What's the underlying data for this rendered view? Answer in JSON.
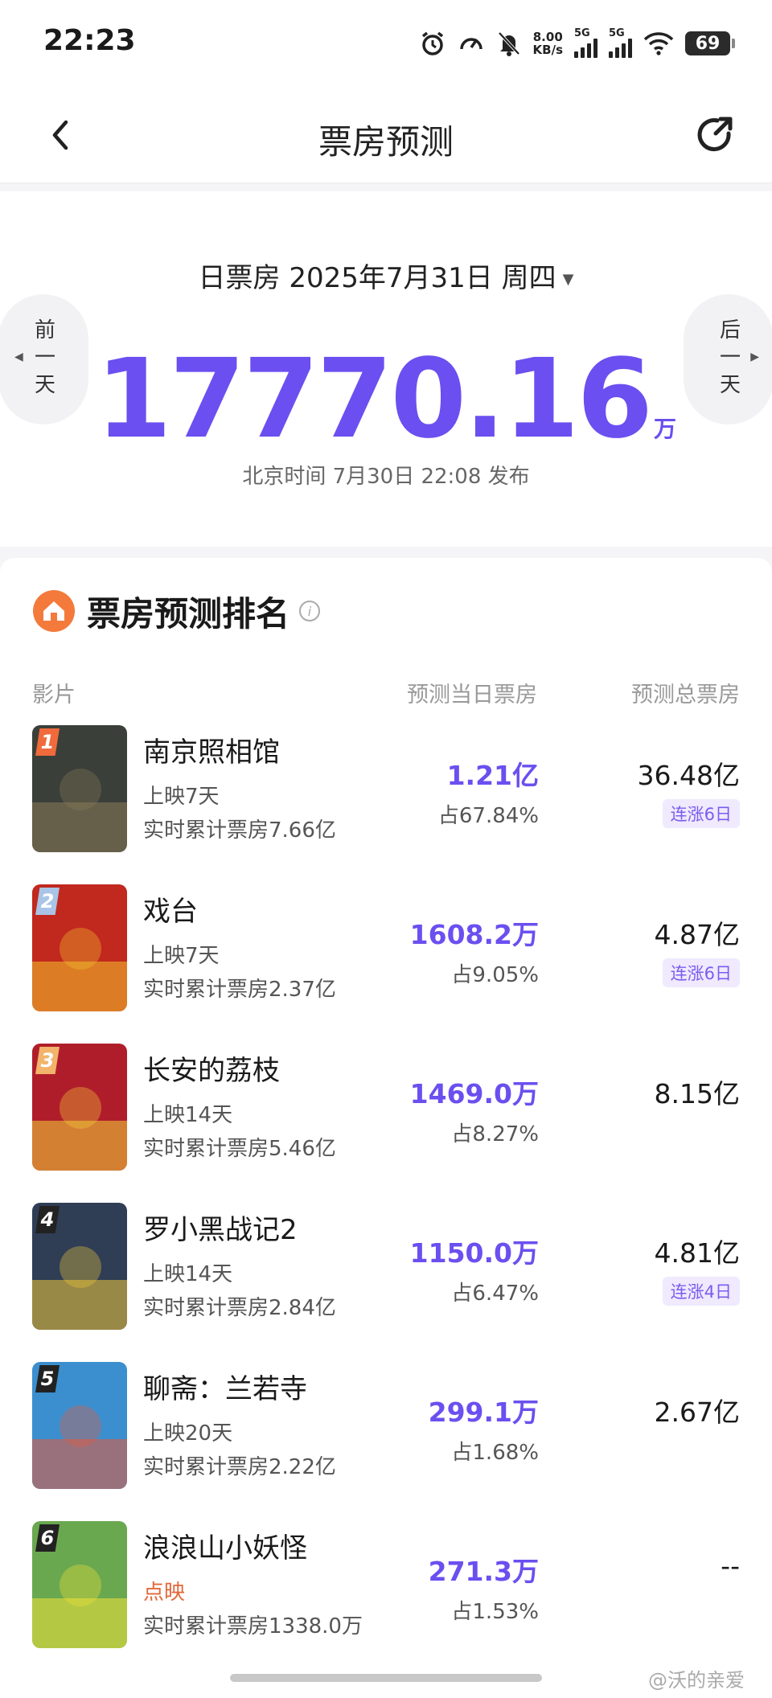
{
  "status_bar": {
    "time": "22:23",
    "net_speed_value": "8.00",
    "net_speed_unit": "KB/s",
    "sim1_label": "5G",
    "sim2_label": "5G",
    "battery": "69"
  },
  "nav": {
    "title": "票房预测"
  },
  "summary": {
    "date_label": "日票房 2025年7月31日 周四",
    "prev_day_label": "前一天",
    "next_day_label": "后一天",
    "total_value": "17770.16",
    "total_unit": "万",
    "publish_time": "北京时间 7月30日 22:08 发布"
  },
  "ranking": {
    "title": "票房预测排名",
    "columns": {
      "movie": "影片",
      "daily": "预测当日票房",
      "total": "预测总票房"
    },
    "movies": [
      {
        "rank": "1",
        "name": "南京照相馆",
        "days": "上映7天",
        "cumulative": "实时累计票房7.66亿",
        "daily": "1.21亿",
        "share": "占67.84%",
        "total": "36.48亿",
        "streak": "连涨6日",
        "badge_color": "#f06a3c",
        "poster_bg": "#3a3f3a",
        "poster_accent": "#8a7b5a"
      },
      {
        "rank": "2",
        "name": "戏台",
        "days": "上映7天",
        "cumulative": "实时累计票房2.37亿",
        "daily": "1608.2万",
        "share": "占9.05%",
        "total": "4.87亿",
        "streak": "连涨6日",
        "badge_color": "#a9c4e6",
        "poster_bg": "#c1281e",
        "poster_accent": "#f3c22d"
      },
      {
        "rank": "3",
        "name": "长安的荔枝",
        "days": "上映14天",
        "cumulative": "实时累计票房5.46亿",
        "daily": "1469.0万",
        "share": "占8.27%",
        "total": "8.15亿",
        "streak": "",
        "badge_color": "#f2b36a",
        "poster_bg": "#b01d2a",
        "poster_accent": "#f3d23a"
      },
      {
        "rank": "4",
        "name": "罗小黑战记2",
        "days": "上映14天",
        "cumulative": "实时累计票房2.84亿",
        "daily": "1150.0万",
        "share": "占6.47%",
        "total": "4.81亿",
        "streak": "连涨4日",
        "badge_color": "#222222",
        "poster_bg": "#2f3d55",
        "poster_accent": "#f1c93a"
      },
      {
        "rank": "5",
        "name": "聊斋：兰若寺",
        "days": "上映20天",
        "cumulative": "实时累计票房2.22亿",
        "daily": "299.1万",
        "share": "占1.68%",
        "total": "2.67亿",
        "streak": "",
        "badge_color": "#222222",
        "poster_bg": "#3b8fcf",
        "poster_accent": "#e85a3a"
      },
      {
        "rank": "6",
        "name": "浪浪山小妖怪",
        "days": "点映",
        "cumulative": "实时累计票房1338.0万",
        "daily": "271.3万",
        "share": "占1.53%",
        "total": "--",
        "streak": "",
        "badge_color": "#222222",
        "poster_bg": "#6aa84f",
        "poster_accent": "#f2e23a"
      }
    ]
  },
  "watermark": "@沃的亲爱"
}
